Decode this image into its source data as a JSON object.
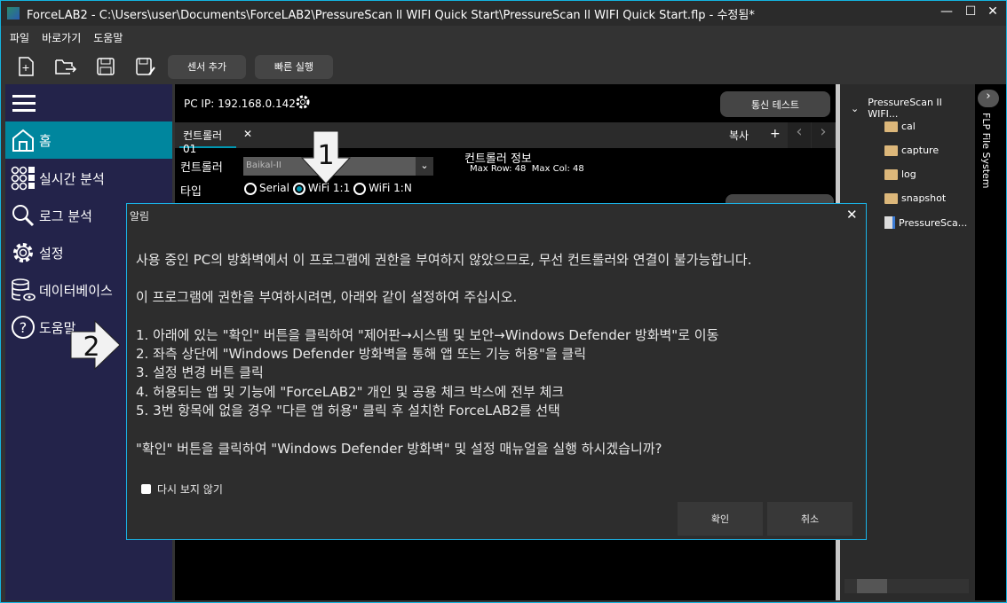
{
  "window": {
    "title": "ForceLAB2 - C:\\Users\\user\\Documents\\ForceLAB2\\PressureScan ll WIFI Quick Start\\PressureScan ll WIFI Quick Start.flp - 수정됨*",
    "minimize": "—",
    "maximize": "☐",
    "close": "✕"
  },
  "menu": [
    "파일",
    "바로가기",
    "도움말"
  ],
  "toolbar": {
    "add_sensor": "센서 추가",
    "quick_run": "빠른 실행"
  },
  "sidebar": {
    "items": [
      {
        "label": "홈",
        "active": true
      },
      {
        "label": "실시간 분석"
      },
      {
        "label": "로그 분석"
      },
      {
        "label": "설정"
      },
      {
        "label": "데이터베이스"
      },
      {
        "label": "도움말"
      }
    ]
  },
  "main": {
    "pc_ip": "PC IP: 192.168.0.142",
    "comm_test": "통신 테스트",
    "tab": "컨트롤러01",
    "tab_close": "✕",
    "copy": "복사",
    "add": "+",
    "prev": "‹",
    "next": "›",
    "controller_label": "컨트롤러",
    "controller_value": "Baikal-II",
    "type_label": "타입",
    "types": [
      {
        "label": "Serial",
        "selected": false
      },
      {
        "label": "WiFi 1:1",
        "selected": true
      },
      {
        "label": "WiFi 1:N",
        "selected": false
      }
    ],
    "info_title": "컨트롤러 정보",
    "info_text": "Max Row: 48  Max Col: 48"
  },
  "file_tree": {
    "root": "PressureScan II WIFI...",
    "items": [
      {
        "name": "cal",
        "type": "folder"
      },
      {
        "name": "capture",
        "type": "folder"
      },
      {
        "name": "log",
        "type": "folder"
      },
      {
        "name": "snapshot",
        "type": "folder"
      },
      {
        "name": "PressureSca...",
        "type": "file"
      }
    ],
    "panel_label": "FLP File System"
  },
  "annotations": {
    "arrow1": "1",
    "arrow2": "2"
  },
  "dialog": {
    "title": "알림",
    "close": "✕",
    "lines": [
      "사용 중인 PC의 방화벽에서 이 프로그램에 권한을 부여하지 않았으므로, 무선 컨트롤러와 연결이 불가능합니다.",
      "이 프로그램에 권한을 부여하시려면, 아래와 같이 설정하여 주십시오.",
      "1. 아래에 있는 \"확인\" 버튼을 클릭하여 \"제어판→시스템 및 보안→Windows Defender 방화벽\"로 이동",
      "2. 좌측 상단에 \"Windows Defender 방화벽을 통해 앱 또는 기능 허용\"을 클릭",
      "3. 설정 변경 버튼 클릭",
      "4. 허용되는 앱 및 기능에 \"ForceLAB2\" 개인 및 공용 체크 박스에 전부 체크",
      "5. 3번 항목에 없을 경우 \"다른 앱 허용\" 클릭 후 설치한 ForceLAB2를 선택",
      "\"확인\" 버튼을 클릭하여 \"Windows Defender 방화벽\" 및 설정 매뉴얼을 실행 하시겠습니까?"
    ],
    "checkbox": "다시 보지 않기",
    "ok": "확인",
    "cancel": "취소"
  }
}
